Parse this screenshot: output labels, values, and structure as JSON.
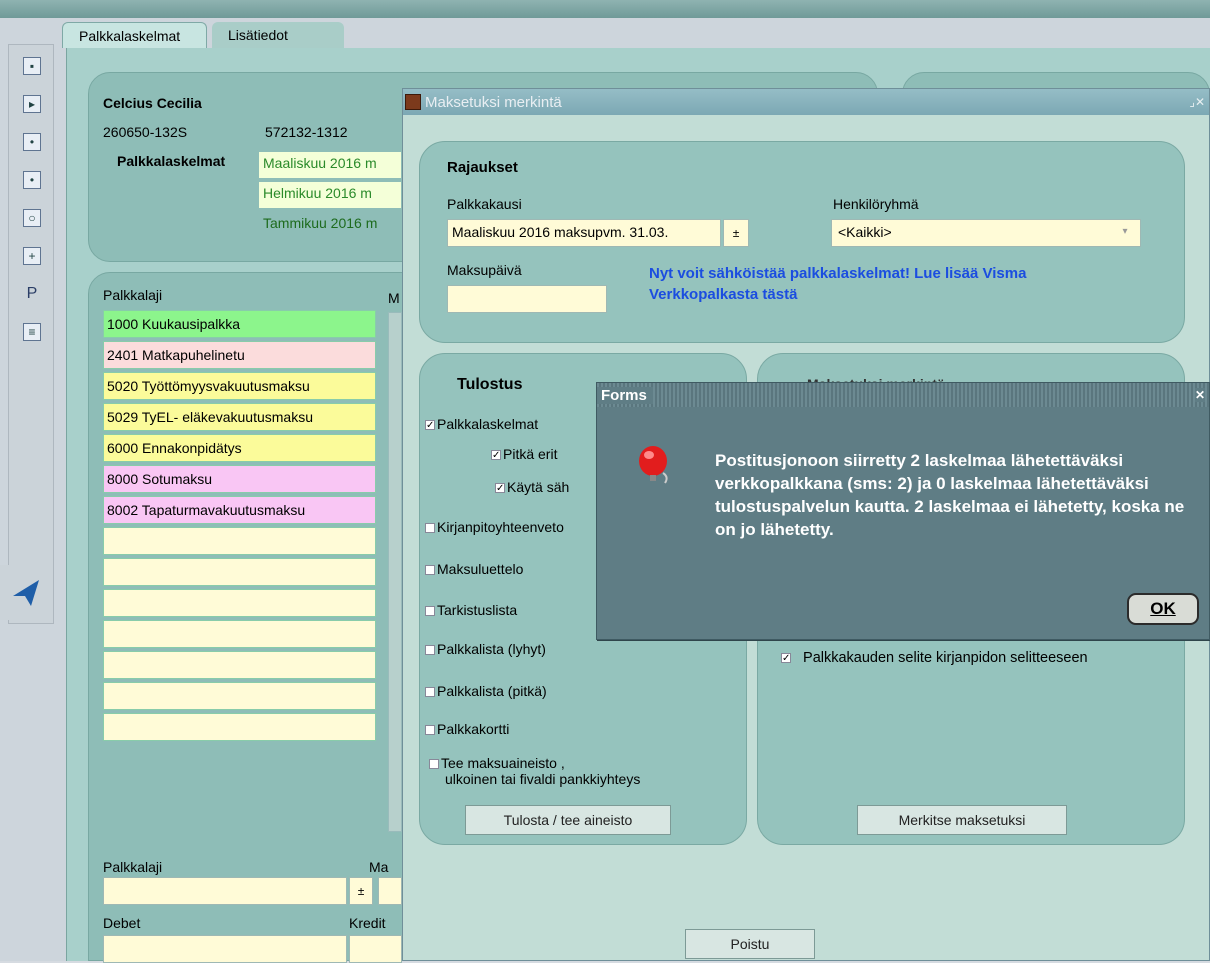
{
  "tabs": [
    {
      "label": "Palkkalaskelmat"
    },
    {
      "label": "Lisätiedot"
    }
  ],
  "toolbar": [
    "save-icon",
    "exit-icon",
    "next-icon",
    "prev-icon",
    "search-icon",
    "new-record-icon",
    "p-icon",
    "print-icon",
    "visma-logo-icon"
  ],
  "toolbar_p_label": "P",
  "employee": {
    "name": "Celcius Cecilia",
    "id": "260650-132S",
    "account": "572132-1312",
    "payslips_label": "Palkkalaskelmat",
    "payslips": [
      {
        "label": "Maaliskuu 2016 m",
        "color": "#f4ffd8"
      },
      {
        "label": "Helmikuu 2016 m",
        "color": "#f4ffd8"
      },
      {
        "label": "Tammikuu 2016 m",
        "color": "#8ebdb7"
      }
    ]
  },
  "salary_list": {
    "label": "Palkkalaji",
    "col2_label": "M",
    "items": [
      {
        "label": "1000 Kuukausipalkka",
        "color": "#8cf58c"
      },
      {
        "label": "2401 Matkapuhelinetu",
        "color": "#fbdcdc"
      },
      {
        "label": "5020 Työttömyysvakuutusmaksu",
        "color": "#fbfb9a"
      },
      {
        "label": "5029 TyEL- eläkevakuutusmaksu",
        "color": "#fbfb9a"
      },
      {
        "label": "6000 Ennakonpidätys",
        "color": "#fbfb9a"
      },
      {
        "label": "8000 Sotumaksu",
        "color": "#f9c6f4"
      },
      {
        "label": "8002 Tapaturmavakuutusmaksu",
        "color": "#f9c6f4"
      },
      {
        "label": "",
        "color": "#fffbd7"
      },
      {
        "label": "",
        "color": "#fffbd7"
      },
      {
        "label": "",
        "color": "#fffbd7"
      },
      {
        "label": "",
        "color": "#fffbd7"
      },
      {
        "label": "",
        "color": "#fffbd7"
      },
      {
        "label": "",
        "color": "#fffbd7"
      },
      {
        "label": "",
        "color": "#fffbd7"
      }
    ]
  },
  "bottom": {
    "palkkalaji_label": "Palkkalaji",
    "m_label": "Ma",
    "debet_label": "Debet",
    "kredit_label": "Kredit"
  },
  "maksetuksi": {
    "title": "Maksetuksi merkintä",
    "rajaukset": "Rajaukset",
    "palkkakausi_label": "Palkkakausi",
    "palkkakausi_value": "Maaliskuu 2016 maksupvm. 31.03.",
    "henkiloryhma_label": "Henkilöryhmä",
    "henkiloryhma_value": "<Kaikki>",
    "maksupaiva_label": "Maksupäivä",
    "maksupaiva_value": "",
    "visma_link": "Nyt voit sähköistää palkkalaskelmat! Lue lisää Visma Verkkopalkasta tästä",
    "tulostus": "Tulostus",
    "options": [
      {
        "label": "Palkkalaskelmat",
        "checked": true
      },
      {
        "label": "Pitkä erit",
        "checked": true
      },
      {
        "label": "Käytä säh",
        "checked": true
      },
      {
        "label": "Kirjanpitoyhteenveto",
        "checked": false
      },
      {
        "label": "Maksuluettelo",
        "checked": false
      },
      {
        "label": "Tarkistuslista",
        "checked": false
      },
      {
        "label": "Palkkalista (lyhyt)",
        "checked": false
      },
      {
        "label": "Palkkalista (pitkä)",
        "checked": false
      },
      {
        "label": "Palkkakortti",
        "checked": false
      },
      {
        "label": "Tee maksuaineisto ,",
        "checked": false
      }
    ],
    "option_extra_line": "ulkoinen tai fivaldi pankkiyhteys",
    "right_panel_title": "Maksetuksi merkintä",
    "selite_label": "Palkkakauden selite kirjanpidon selitteeseen",
    "selite_checked": true,
    "tulosta_button": "Tulosta / tee aineisto",
    "merkitse_button": "Merkitse maksetuksi",
    "poistu_button": "Poistu"
  },
  "forms_dialog": {
    "title": "Forms",
    "message": "Postitusjonoon siirretty 2 laskelmaa lähetettäväksi verkkopalkkana (sms: 2) ja 0 laskelmaa lähetettäväksi tulostuspalvelun kautta. 2 laskelmaa ei lähetetty, koska ne on jo lähetetty.",
    "ok_label": "OK",
    "icon": "alert-bell-icon"
  }
}
